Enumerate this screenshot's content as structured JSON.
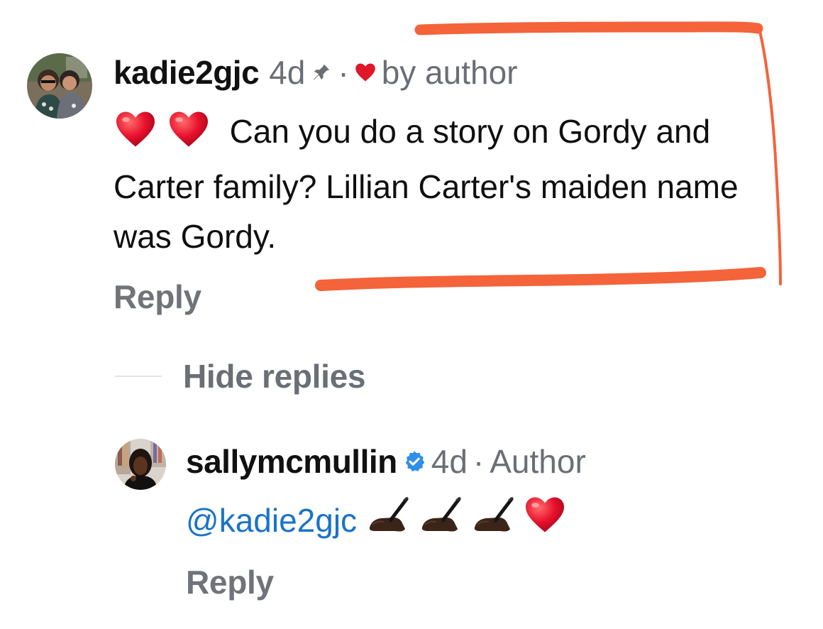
{
  "colors": {
    "mention_blue": "#1a73c9",
    "grey_text": "#6b6f75",
    "heart_red": "#e0162b",
    "verified_blue": "#2f8fe8",
    "annotation_orange": "#f4633a"
  },
  "comment": {
    "username": "kadie2gjc",
    "age": "4d",
    "pin_icon": "pin-icon",
    "separator": "·",
    "heart_icon": "heart-icon",
    "liked_by": "by author",
    "text": "Can you do a story on Gordy and Carter family?  Lillian Carter's maiden name was Gordy.",
    "reply_label": "Reply"
  },
  "replies_toggle": {
    "label": "Hide replies"
  },
  "reply": {
    "username": "sallymcmullin",
    "verified_icon": "verified-badge-icon",
    "age": "4d",
    "separator": "·",
    "role": "Author",
    "mention": "@kadie2gjc",
    "emojis": [
      "writing-hand-icon",
      "writing-hand-icon",
      "writing-hand-icon",
      "heart-icon"
    ],
    "reply_label": "Reply"
  }
}
